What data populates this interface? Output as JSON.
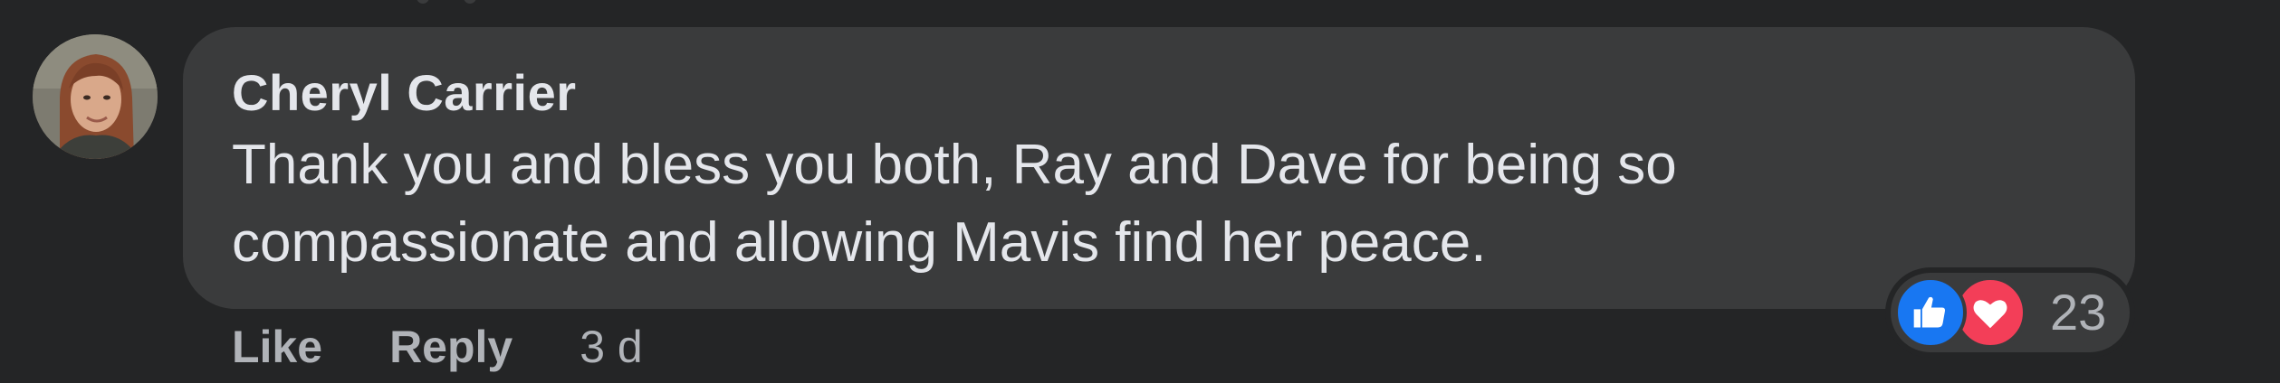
{
  "comment": {
    "author": "Cheryl Carrier",
    "text_lines": [
      "Thank you and bless you both, Ray and Dave for being so",
      "compassionate and allowing Mavis find her peace."
    ],
    "actions": {
      "like_label": "Like",
      "reply_label": "Reply",
      "timestamp": "3 d"
    },
    "reactions": {
      "icons": [
        "thumbs-up-icon",
        "heart-icon"
      ],
      "count": "23"
    }
  },
  "colors": {
    "background": "#242526",
    "bubble": "#3a3b3c",
    "primary_text": "#e4e6eb",
    "secondary_text": "#b0b3b8",
    "like_blue": "#1877f2",
    "love_red": "#f33e58"
  }
}
